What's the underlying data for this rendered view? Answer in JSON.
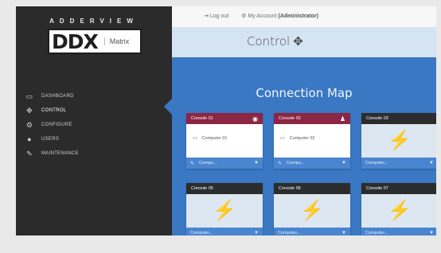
{
  "brand": {
    "line": "ADDERVIEW",
    "logo_main": "DDX",
    "logo_sub": "Matrix"
  },
  "header": {
    "logout_label": "Log out",
    "account_label": "My Account",
    "account_role": "(Administrator)"
  },
  "section": {
    "title": "Control"
  },
  "nav": [
    {
      "label": "DASHBOARD",
      "icon": "monitor-icon"
    },
    {
      "label": "CONTROL",
      "icon": "move-icon"
    },
    {
      "label": "CONFIGURE",
      "icon": "gears-icon"
    },
    {
      "label": "USERS",
      "icon": "users-icon"
    },
    {
      "label": "MAINTENANCE",
      "icon": "wrench-icon"
    }
  ],
  "map": {
    "title": "Connection Map",
    "consoles": [
      {
        "name": "Console 01",
        "computer": "Computer 01",
        "select": "Compu...",
        "status_icon": "eye-icon"
      },
      {
        "name": "Console 02",
        "computer": "Computer 02",
        "select": "Compu...",
        "status_icon": "user-icon"
      },
      {
        "name": "Console 03",
        "computer": "",
        "select": "Computer..."
      },
      {
        "name": "Console 05",
        "computer": "",
        "select": "Computer..."
      },
      {
        "name": "Console 06",
        "computer": "",
        "select": "Computer..."
      },
      {
        "name": "Console 07",
        "computer": "",
        "select": "Computer..."
      }
    ]
  },
  "colors": {
    "sidebar": "#2b2b2b",
    "content_bg": "#3a78c4",
    "card_connected_header": "#8c2644",
    "card_idle_header": "#2c2c2c",
    "card_footer": "#4a86cf"
  }
}
